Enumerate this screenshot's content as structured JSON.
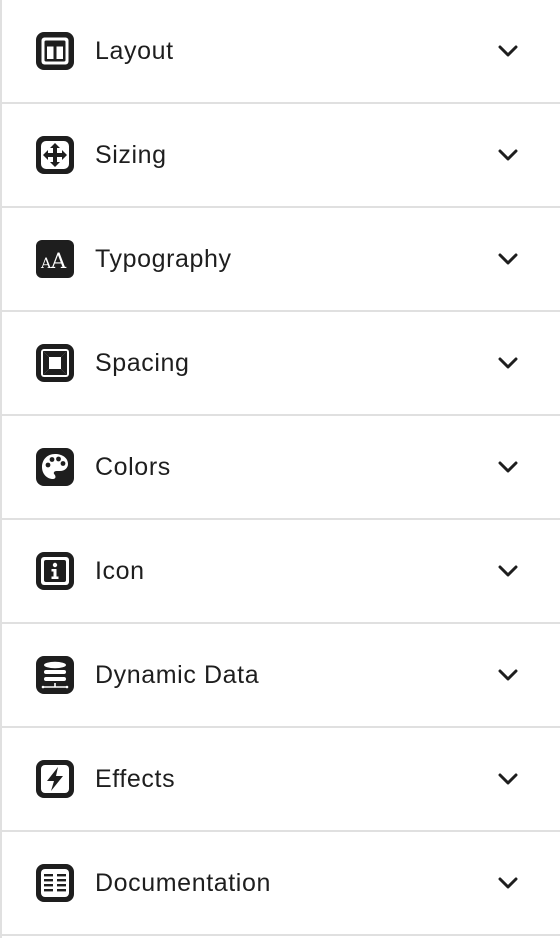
{
  "sections": [
    {
      "label": "Layout",
      "icon": "layout-icon",
      "expanded": false
    },
    {
      "label": "Sizing",
      "icon": "sizing-icon",
      "expanded": false
    },
    {
      "label": "Typography",
      "icon": "typography-icon",
      "expanded": false
    },
    {
      "label": "Spacing",
      "icon": "spacing-icon",
      "expanded": false
    },
    {
      "label": "Colors",
      "icon": "colors-icon",
      "expanded": false
    },
    {
      "label": "Icon",
      "icon": "info-icon",
      "expanded": false
    },
    {
      "label": "Dynamic Data",
      "icon": "database-icon",
      "expanded": false
    },
    {
      "label": "Effects",
      "icon": "effects-icon",
      "expanded": false
    },
    {
      "label": "Documentation",
      "icon": "documentation-icon",
      "expanded": false
    }
  ],
  "colors": {
    "text": "#1e1e1e",
    "divider": "#e0e0e0",
    "background": "#ffffff"
  }
}
